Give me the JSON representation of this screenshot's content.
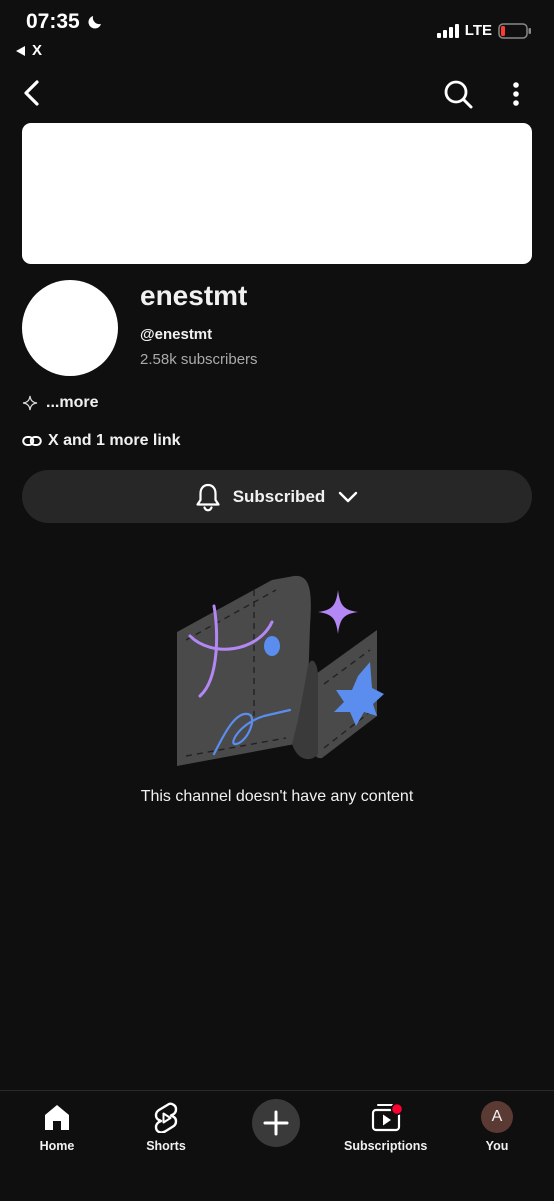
{
  "status_bar": {
    "time": "07:35",
    "back_app": "X",
    "network": "LTE",
    "icons": [
      "moon-icon",
      "signal-icon",
      "battery-icon"
    ]
  },
  "header": {
    "icons": [
      "back-icon",
      "search-icon",
      "more-vertical-icon"
    ]
  },
  "channel": {
    "name": "enestmt",
    "handle": "@enestmt",
    "subscribers": "2.58k subscribers",
    "description_more": "...more",
    "links_text": "X and 1 more link"
  },
  "subscribe_button": {
    "label": "Subscribed",
    "icons": [
      "bell-icon",
      "chevron-down-icon"
    ]
  },
  "empty_state": {
    "message": "This channel doesn't have any content"
  },
  "bottom_nav": {
    "items": [
      {
        "label": "Home",
        "icon": "home-icon"
      },
      {
        "label": "Shorts",
        "icon": "shorts-icon"
      },
      {
        "label": "",
        "icon": "plus-icon"
      },
      {
        "label": "Subscriptions",
        "icon": "subscriptions-icon"
      },
      {
        "label": "You",
        "icon": "avatar",
        "avatar_letter": "A"
      }
    ]
  },
  "colors": {
    "background": "#0f0f0f",
    "button_bg": "#272727",
    "text": "#f1f1f1",
    "secondary_text": "#aaaaaa",
    "notification_dot": "#ff0033",
    "accent_purple": "#b388f5",
    "accent_blue": "#5b8def"
  }
}
